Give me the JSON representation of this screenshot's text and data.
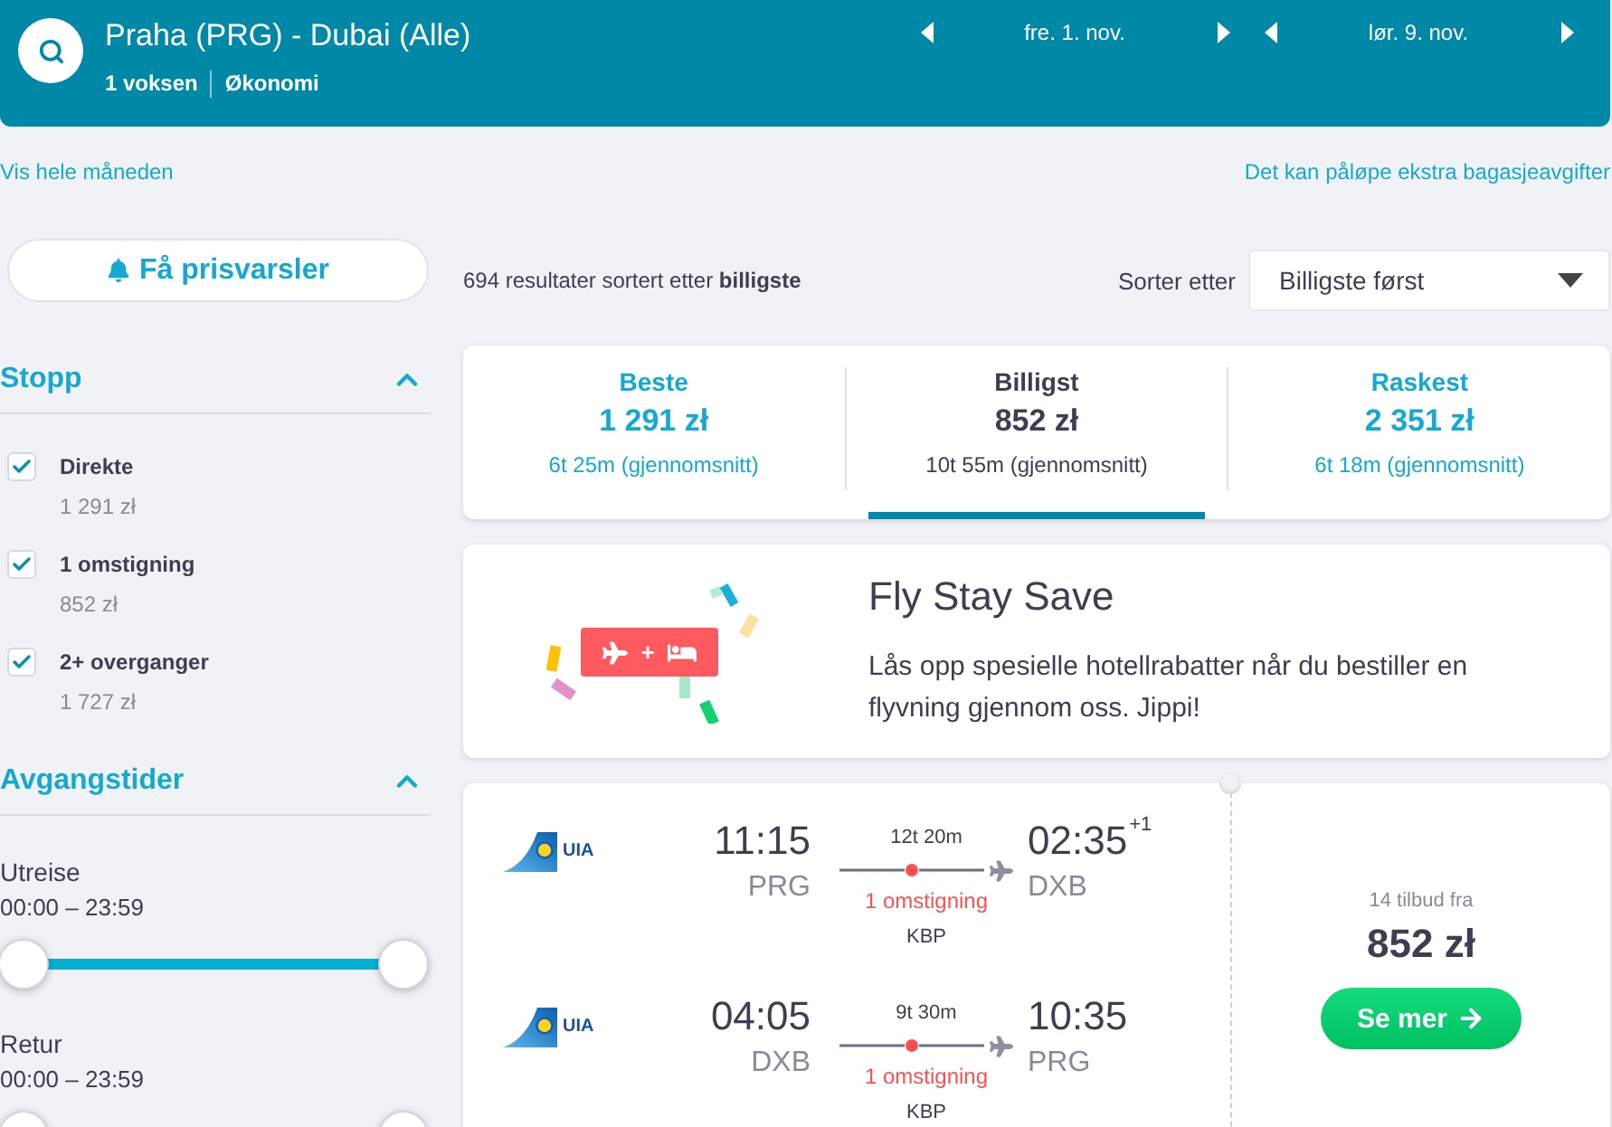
{
  "header": {
    "route": "Praha (PRG) - Dubai (Alle)",
    "passengers": "1 voksen",
    "cabin": "Økonomi",
    "dates": [
      {
        "label": "fre. 1. nov."
      },
      {
        "label": "lør. 9. nov."
      }
    ]
  },
  "links": {
    "month_view": "Vis hele måneden",
    "baggage_notice": "Det kan påløpe ekstra bagasjeavgifter"
  },
  "sidebar": {
    "alert_button": "Få prisvarsler",
    "sections": [
      {
        "kind": "checkboxes",
        "title": "Stopp",
        "expanded": true,
        "options": [
          {
            "label": "Direkte",
            "price": "1 291 zł",
            "checked": true
          },
          {
            "label": "1 omstigning",
            "price": "852 zł",
            "checked": true
          },
          {
            "label": "2+ overganger",
            "price": "1 727 zł",
            "checked": true
          }
        ]
      },
      {
        "kind": "sliders",
        "title": "Avgangstider",
        "expanded": true,
        "sliders": [
          {
            "label": "Utreise",
            "range": "00:00 – 23:59",
            "level": 1
          },
          {
            "label": "Retur",
            "range": "00:00 – 23:59",
            "level": 1
          }
        ]
      }
    ]
  },
  "results": {
    "summary": "694 resultater sortert etter **billigste**",
    "sort_label": "Sorter etter",
    "sort_value": "Billigste først"
  },
  "sort_tabs": [
    {
      "title": "Beste",
      "price": "1 291 zł",
      "duration": "6t 25m (gjennomsnitt)",
      "selected": false
    },
    {
      "title": "Billigst",
      "price": "852 zł",
      "duration": "10t 55m (gjennomsnitt)",
      "selected": true
    },
    {
      "title": "Raskest",
      "price": "2 351 zł",
      "duration": "6t 18m (gjennomsnitt)",
      "selected": false
    }
  ],
  "promo": {
    "title": "Fly Stay Save",
    "badge_plus": "+",
    "text": "Lås opp spesielle hotellrabatter når du bestiller en flyvning gjennom oss. Jippi!"
  },
  "flight": {
    "legs": [
      {
        "airline": "UIA",
        "depart_time": "11:15",
        "depart_airport": "PRG",
        "duration": "12t 20m",
        "stops": "1 omstigning",
        "via": "KBP",
        "arrive_time": "02:35",
        "day_offset": "+1",
        "arrive_airport": "DXB"
      },
      {
        "airline": "UIA",
        "depart_time": "04:05",
        "depart_airport": "DXB",
        "duration": "9t 30m",
        "stops": "1 omstigning",
        "via": "KBP",
        "arrive_time": "10:35",
        "arrive_airport": "PRG"
      }
    ],
    "offers": "14 tilbud fra",
    "price": "852 zł",
    "button": "Se mer"
  }
}
